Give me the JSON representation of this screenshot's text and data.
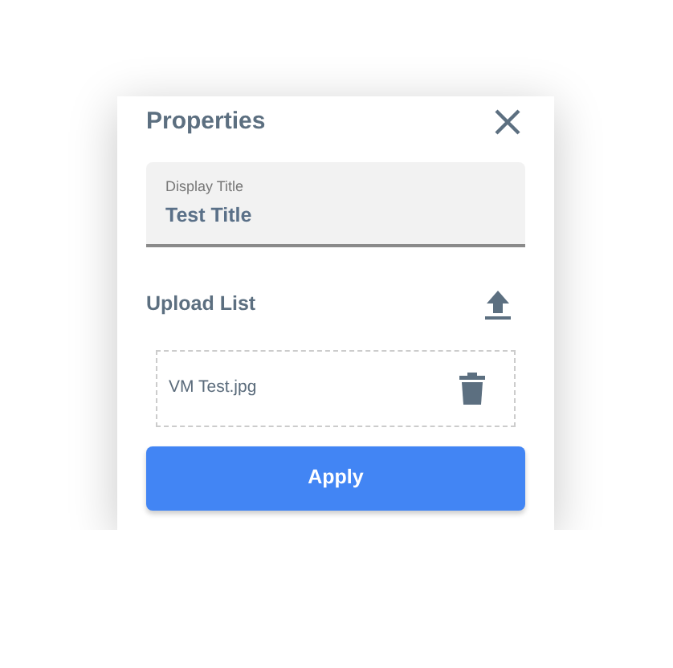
{
  "panel": {
    "title": "Properties"
  },
  "display_title": {
    "label": "Display Title",
    "value": "Test Title"
  },
  "upload": {
    "heading": "Upload List",
    "files": [
      {
        "name": "VM Test.jpg"
      }
    ]
  },
  "apply_button": "Apply"
}
